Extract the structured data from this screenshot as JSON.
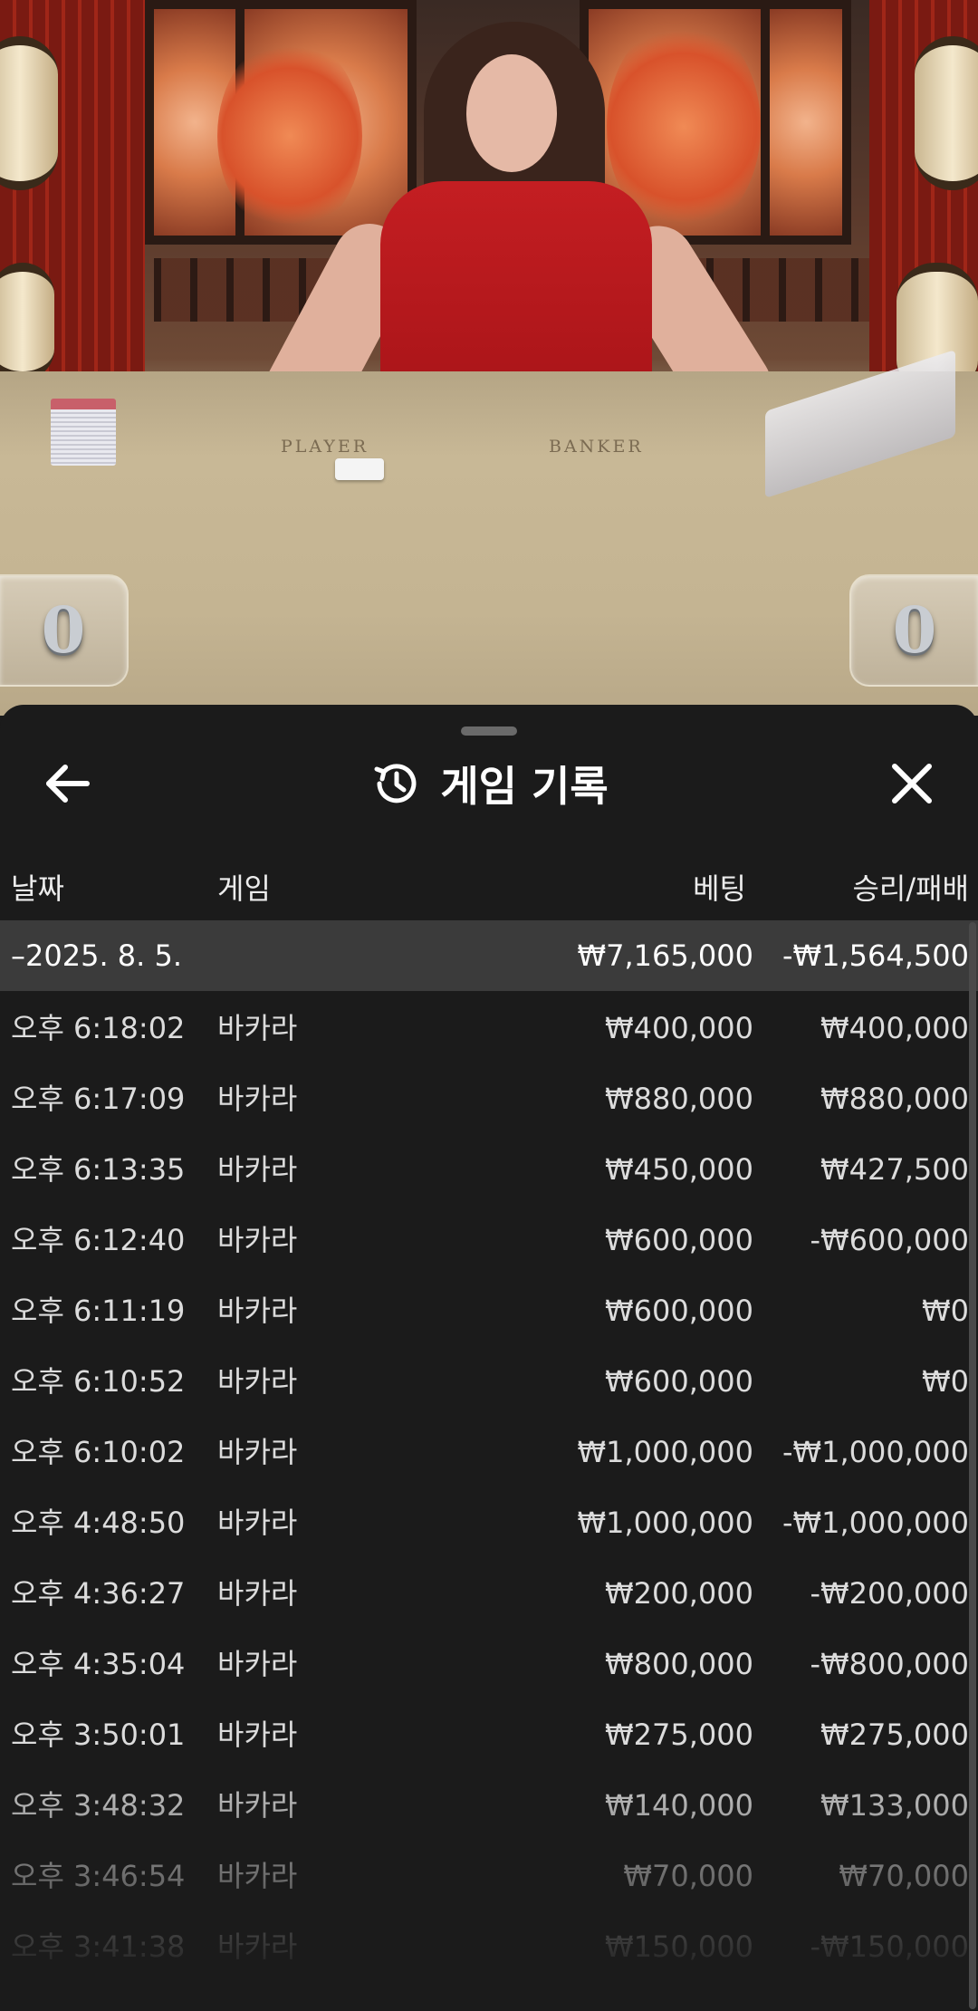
{
  "stream": {
    "table_labels": {
      "player": "PLAYER",
      "banker": "BANKER"
    },
    "player_score": "0",
    "banker_score": "0"
  },
  "panel": {
    "title": "게임 기록",
    "icons": {
      "back": "arrow-left-icon",
      "history": "history-icon",
      "close": "close-icon"
    },
    "columns": {
      "date": "날짜",
      "game": "게임",
      "bet": "베팅",
      "win_loss": "승리/패배"
    }
  },
  "summary": {
    "date": "–2025. 8. 5.",
    "bet": "₩7,165,000",
    "win_loss": "-₩1,564,500"
  },
  "rows": [
    {
      "time": "오후 6:18:02",
      "game": "바카라",
      "bet": "₩400,000",
      "win_loss": "₩400,000"
    },
    {
      "time": "오후 6:17:09",
      "game": "바카라",
      "bet": "₩880,000",
      "win_loss": "₩880,000"
    },
    {
      "time": "오후 6:13:35",
      "game": "바카라",
      "bet": "₩450,000",
      "win_loss": "₩427,500"
    },
    {
      "time": "오후 6:12:40",
      "game": "바카라",
      "bet": "₩600,000",
      "win_loss": "-₩600,000"
    },
    {
      "time": "오후 6:11:19",
      "game": "바카라",
      "bet": "₩600,000",
      "win_loss": "₩0"
    },
    {
      "time": "오후 6:10:52",
      "game": "바카라",
      "bet": "₩600,000",
      "win_loss": "₩0"
    },
    {
      "time": "오후 6:10:02",
      "game": "바카라",
      "bet": "₩1,000,000",
      "win_loss": "-₩1,000,000"
    },
    {
      "time": "오후 4:48:50",
      "game": "바카라",
      "bet": "₩1,000,000",
      "win_loss": "-₩1,000,000"
    },
    {
      "time": "오후 4:36:27",
      "game": "바카라",
      "bet": "₩200,000",
      "win_loss": "-₩200,000"
    },
    {
      "time": "오후 4:35:04",
      "game": "바카라",
      "bet": "₩800,000",
      "win_loss": "-₩800,000"
    },
    {
      "time": "오후 3:50:01",
      "game": "바카라",
      "bet": "₩275,000",
      "win_loss": "₩275,000"
    },
    {
      "time": "오후 3:48:32",
      "game": "바카라",
      "bet": "₩140,000",
      "win_loss": "₩133,000"
    },
    {
      "time": "오후 3:46:54",
      "game": "바카라",
      "bet": "₩70,000",
      "win_loss": "₩70,000"
    },
    {
      "time": "오후 3:41:38",
      "game": "바카라",
      "bet": "₩150,000",
      "win_loss": "-₩150,000"
    }
  ]
}
